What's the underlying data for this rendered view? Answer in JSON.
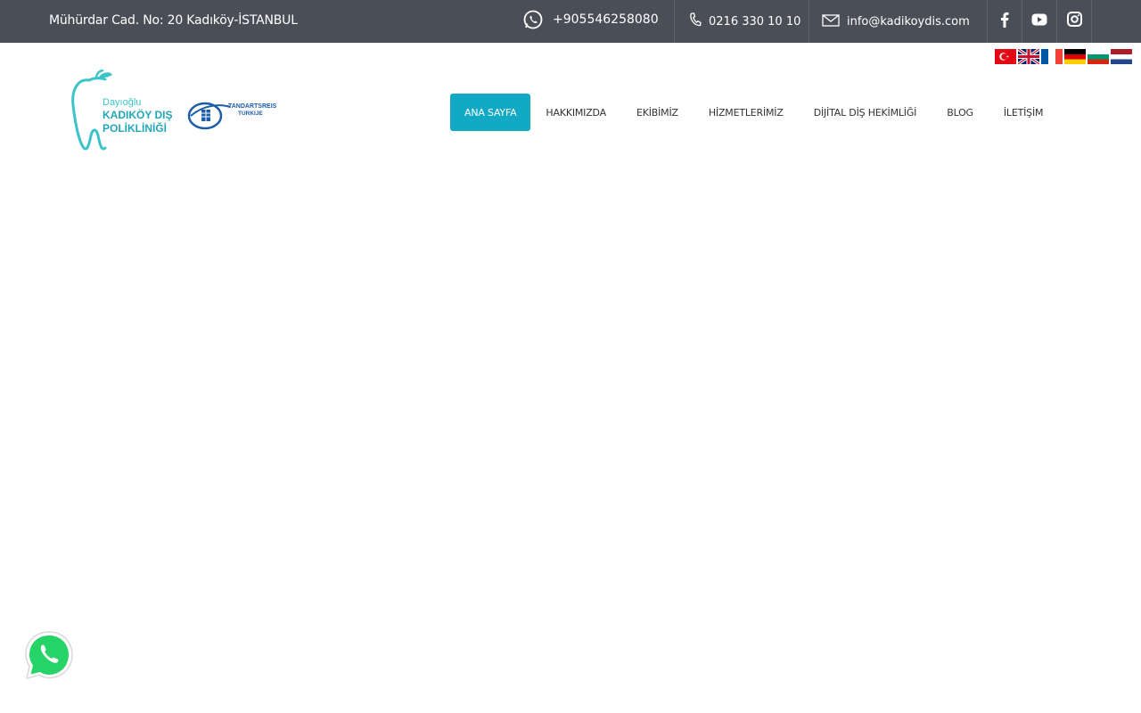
{
  "topbar": {
    "address": "Mühürdar Cad. No: 20 Kadıköy-İSTANBUL",
    "whatsapp_number": "+905546258080",
    "phone": "0216 330 10 10",
    "email": "info@kadikoydis.com"
  },
  "social": [
    "facebook-icon",
    "youtube-icon",
    "instagram-icon"
  ],
  "languages": [
    "tr",
    "en",
    "fr",
    "de",
    "bg",
    "nl"
  ],
  "logo": {
    "brand_top": "Dayıoğlu",
    "brand_mid": "KADIKÖY DIŞ",
    "brand_bottom": "POLİKLİNİĞİ",
    "partner": "TANDARTSREIS",
    "partner_sub": "TURKIJE"
  },
  "nav": {
    "items": [
      "ANA SAYFA",
      "HAKKIMIZDA",
      "EKİBİMİZ",
      "HİZMETLERİMİZ",
      "DİJİTAL DİŞ HEKİMLİĞİ",
      "BLOG",
      "İLETİŞİM"
    ]
  },
  "colors": {
    "topbar": "#4a4f57",
    "accent": "#12a9c5",
    "whatsapp": "#25d366"
  }
}
